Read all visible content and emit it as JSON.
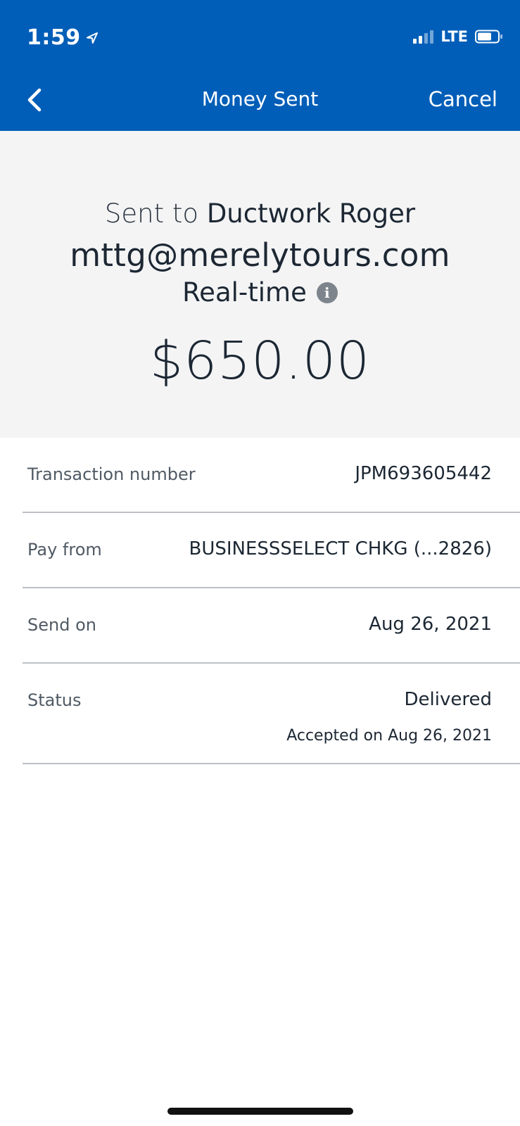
{
  "status_bar": {
    "time": "1:59",
    "network": "LTE"
  },
  "nav": {
    "title": "Money Sent",
    "cancel_label": "Cancel"
  },
  "summary": {
    "sent_prefix": "Sent to",
    "recipient_name": "Ductwork Roger",
    "recipient_email": "mttg@merelytours.com",
    "delivery_speed": "Real-time",
    "amount": "$650.00"
  },
  "details": {
    "transaction_number_label": "Transaction number",
    "transaction_number_value": "JPM693605442",
    "pay_from_label": "Pay from",
    "pay_from_value": "BUSINESSSELECT CHKG (...2826)",
    "send_on_label": "Send on",
    "send_on_value": "Aug 26, 2021",
    "status_label": "Status",
    "status_value": "Delivered",
    "status_sub": "Accepted on Aug 26, 2021"
  },
  "colors": {
    "brand_blue": "#005eb8",
    "summary_bg": "#f4f4f5",
    "divider": "#bcc0c4"
  }
}
